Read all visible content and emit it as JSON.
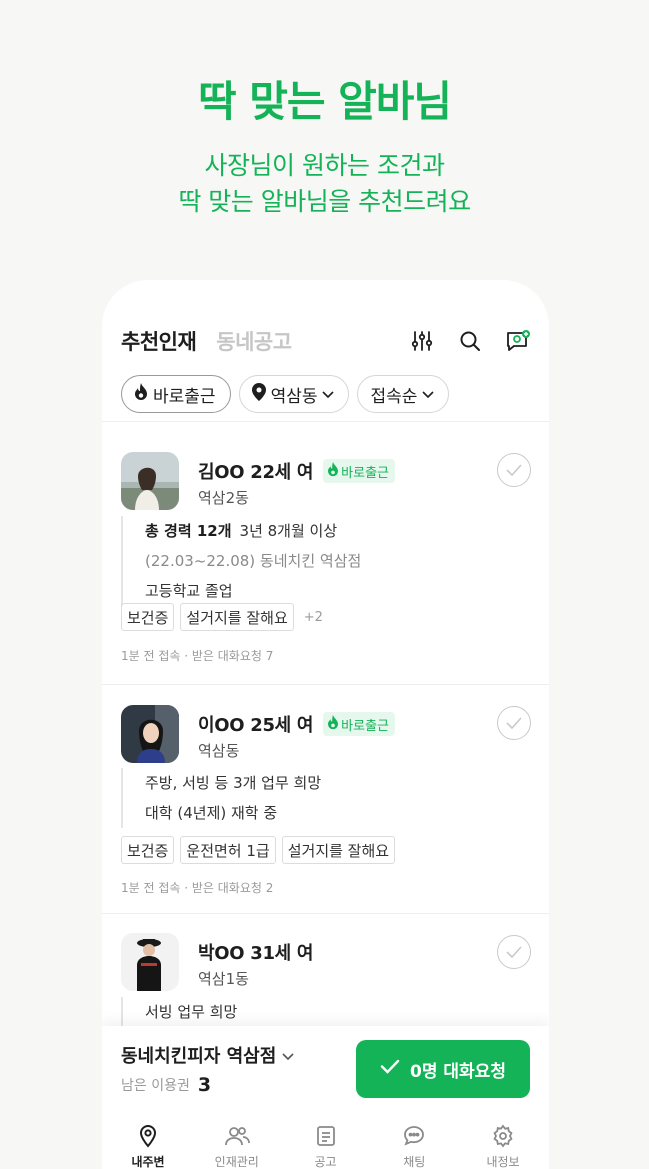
{
  "hero": {
    "title": "딱 맞는 알바님",
    "subtitle_line1": "사장님이 원하는 조건과",
    "subtitle_line2": "딱 맞는 알바님을 추천드려요"
  },
  "topbar": {
    "tabs": [
      {
        "label": "추천인재",
        "active": true
      },
      {
        "label": "동네공고",
        "active": false
      }
    ],
    "icons": [
      "filter-icon",
      "search-icon",
      "chat-add-icon"
    ]
  },
  "filters": [
    {
      "label": "바로출근",
      "icon": "flame-icon"
    },
    {
      "label": "역삼동",
      "icon": "location-pin-icon",
      "dropdown": true
    },
    {
      "label": "접속순",
      "dropdown": true
    }
  ],
  "candidates": [
    {
      "name": "김OO 22세 여",
      "badge": "바로출근",
      "location": "역삼2동",
      "career_label": "총 경력 12개",
      "career_value": "3년 8개월 이상",
      "career_detail": "(22.03~22.08) 동네치킨 역삼점",
      "education": "고등학교 졸업",
      "tags": [
        "보건증",
        "설거지를 잘해요"
      ],
      "tags_more": "+2",
      "meta": "1분 전 접속 · 받은 대화요청 7"
    },
    {
      "name": "이OO 25세 여",
      "badge": "바로출근",
      "location": "역삼동",
      "wish": "주방, 서빙 등 3개 업무 희망",
      "education": "대학 (4년제) 재학 중",
      "tags": [
        "보건증",
        "운전면허 1급",
        "설거지를 잘해요"
      ],
      "meta": "1분 전 접속 · 받은 대화요청 2"
    },
    {
      "name": "박OO 31세 여",
      "location": "역삼1동",
      "wish": "서빙 업무 희망"
    }
  ],
  "bottom": {
    "store_name": "동네치킨피자 역삼점",
    "remain_label": "남은 이용권",
    "remain_count": "3",
    "cta_label": "0명 대화요청"
  },
  "nav": [
    {
      "label": "내주변",
      "icon": "location-icon",
      "active": true
    },
    {
      "label": "인재관리",
      "icon": "people-icon",
      "active": false
    },
    {
      "label": "공고",
      "icon": "document-icon",
      "active": false
    },
    {
      "label": "채팅",
      "icon": "chat-icon",
      "active": false
    },
    {
      "label": "내정보",
      "icon": "gear-icon",
      "active": false
    }
  ],
  "colors": {
    "brand": "#15b357",
    "badge_bg": "#e6f7ed"
  }
}
